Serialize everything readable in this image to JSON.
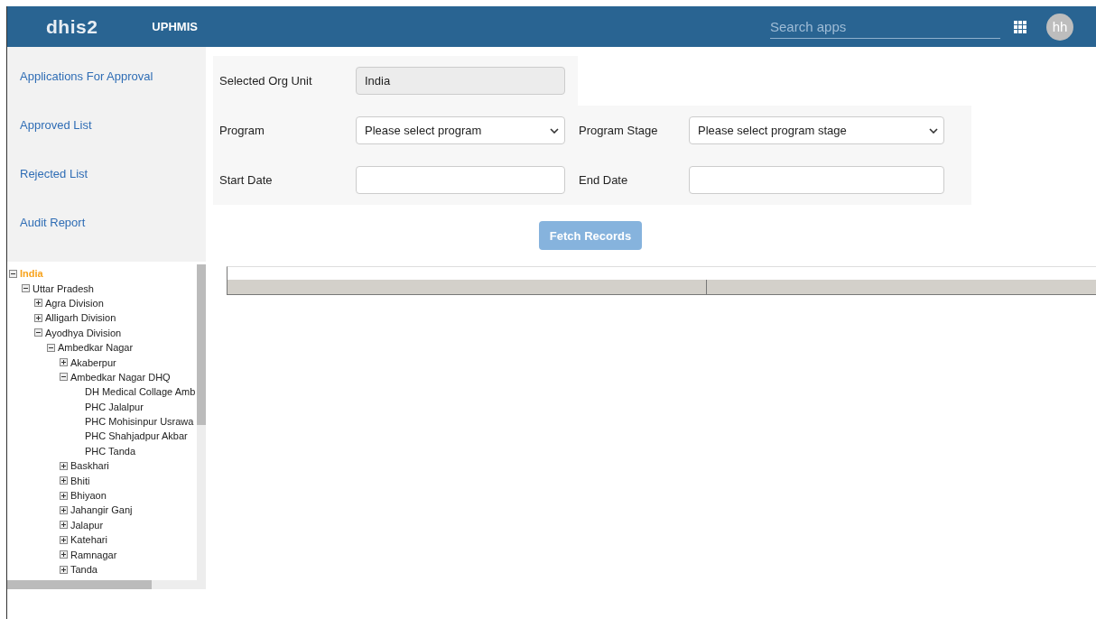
{
  "header": {
    "logo": "dhis2",
    "app_title": "UPHMIS",
    "search": {
      "placeholder": "Search apps"
    },
    "avatar": "hh"
  },
  "sidebar": {
    "items": [
      {
        "label": "Applications For Approval",
        "selected": false
      },
      {
        "label": "Approved List",
        "selected": false
      },
      {
        "label": "Rejected List",
        "selected": false
      },
      {
        "label": "Audit Report",
        "selected": false
      }
    ]
  },
  "org_tree": [
    {
      "label": "India",
      "selected": true,
      "expanded": true,
      "children": [
        {
          "label": "Uttar Pradesh",
          "selected": false,
          "expanded": true,
          "children": [
            {
              "label": "Agra Division",
              "selected": false,
              "expanded": false
            },
            {
              "label": "Alligarh Division",
              "selected": false,
              "expanded": false
            },
            {
              "label": "Ayodhya Division",
              "selected": false,
              "expanded": true,
              "children": [
                {
                  "label": "Ambedkar Nagar",
                  "selected": false,
                  "expanded": true,
                  "children": [
                    {
                      "label": "Akaberpur",
                      "selected": false,
                      "expanded": false
                    },
                    {
                      "label": "Ambedkar Nagar DHQ",
                      "selected": false,
                      "expanded": true,
                      "children": [
                        {
                          "label": "DH Medical Collage Amb",
                          "selected": false
                        },
                        {
                          "label": "PHC Jalalpur",
                          "selected": false
                        },
                        {
                          "label": "PHC Mohisinpur Usrawa",
                          "selected": false
                        },
                        {
                          "label": "PHC Shahjadpur Akbar",
                          "selected": false
                        },
                        {
                          "label": "PHC Tanda",
                          "selected": false
                        }
                      ]
                    },
                    {
                      "label": "Baskhari",
                      "selected": false,
                      "expanded": false
                    },
                    {
                      "label": "Bhiti",
                      "selected": false,
                      "expanded": false
                    },
                    {
                      "label": "Bhiyaon",
                      "selected": false,
                      "expanded": false
                    },
                    {
                      "label": "Jahangir Ganj",
                      "selected": false,
                      "expanded": false
                    },
                    {
                      "label": "Jalapur",
                      "selected": false,
                      "expanded": false
                    },
                    {
                      "label": "Katehari",
                      "selected": false,
                      "expanded": false
                    },
                    {
                      "label": "Ramnagar",
                      "selected": false,
                      "expanded": false
                    },
                    {
                      "label": "Tanda",
                      "selected": false,
                      "expanded": false
                    }
                  ]
                }
              ]
            }
          ]
        }
      ]
    }
  ],
  "form": {
    "org_unit": {
      "label": "Selected Org Unit",
      "value": "India"
    },
    "program": {
      "label": "Program",
      "value": "Please select program"
    },
    "program_stage": {
      "label": "Program Stage",
      "value": "Please select program stage"
    },
    "start_date": {
      "label": "Start Date"
    },
    "end_date": {
      "label": "End Date"
    },
    "fetch_button": {
      "label": "Fetch Records",
      "disabled": true
    }
  }
}
